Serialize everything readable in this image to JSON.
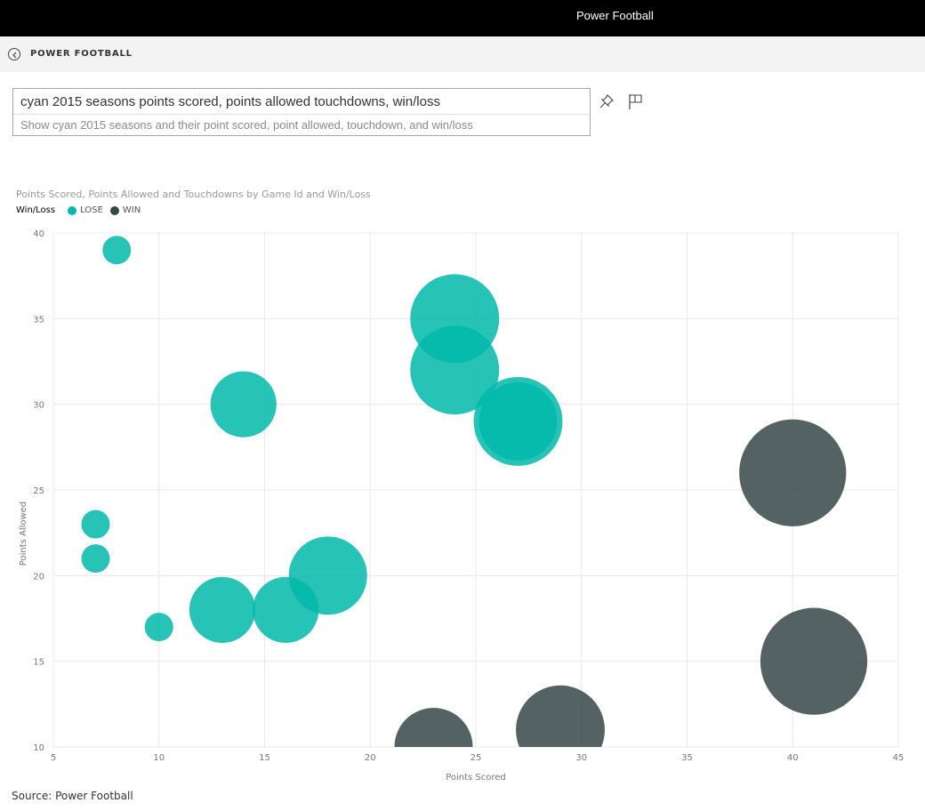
{
  "app": {
    "title": "Power Football"
  },
  "nav": {
    "breadcrumb": "POWER FOOTBALL",
    "back_icon": "back-circle-icon"
  },
  "qa": {
    "query": "cyan 2015 seasons points scored, points allowed touchdowns, win/loss",
    "restatement": "Show cyan 2015 seasons and their point scored, point allowed, touchdown, and win/loss",
    "pin_icon": "pin-icon",
    "flag_icon": "flag-icon"
  },
  "colors": {
    "lose": "#01b8aa",
    "win": "#374649",
    "grid": "#e8e8e8",
    "axis_text": "#777777"
  },
  "source": "Source: Power Football",
  "chart_data": {
    "type": "scatter",
    "title": "Points Scored, Points Allowed and Touchdowns by Game Id and Win/Loss",
    "legend": {
      "title": "Win/Loss",
      "placement": "top-left",
      "entries": [
        "LOSE",
        "WIN"
      ]
    },
    "xlabel": "Points Scored",
    "ylabel": "Points Allowed",
    "size_field": "Touchdowns",
    "xlim": [
      5,
      45
    ],
    "ylim": [
      10,
      40
    ],
    "xticks": [
      5,
      10,
      15,
      20,
      25,
      30,
      35,
      40,
      45
    ],
    "yticks": [
      10,
      15,
      20,
      25,
      30,
      35,
      40
    ],
    "grid": true,
    "series": [
      {
        "name": "LOSE",
        "points": [
          {
            "x": 8,
            "y": 39,
            "size": 0
          },
          {
            "x": 7,
            "y": 23,
            "size": 0
          },
          {
            "x": 7,
            "y": 21,
            "size": 0
          },
          {
            "x": 10,
            "y": 17,
            "size": 0
          },
          {
            "x": 13,
            "y": 18,
            "size": 2
          },
          {
            "x": 16,
            "y": 18,
            "size": 2
          },
          {
            "x": 14,
            "y": 30,
            "size": 2
          },
          {
            "x": 18,
            "y": 20,
            "size": 3
          },
          {
            "x": 24,
            "y": 35,
            "size": 4
          },
          {
            "x": 24,
            "y": 32,
            "size": 4
          },
          {
            "x": 27,
            "y": 29,
            "size": 4
          },
          {
            "x": 27,
            "y": 29,
            "size": 3
          }
        ]
      },
      {
        "name": "WIN",
        "points": [
          {
            "x": 40,
            "y": 26,
            "size": 6
          },
          {
            "x": 41,
            "y": 15,
            "size": 6
          },
          {
            "x": 23,
            "y": 10,
            "size": 3
          },
          {
            "x": 29,
            "y": 11,
            "size": 4
          }
        ]
      }
    ]
  }
}
